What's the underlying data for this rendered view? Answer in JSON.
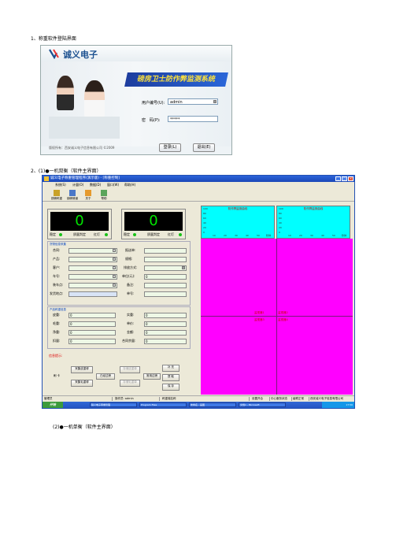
{
  "headings": {
    "step1": "1、称重软件登陆界面",
    "step2": "2、(1)●一机双衡（软件主界面）",
    "step3": "(2)●一机单衡（软件主界面）"
  },
  "login": {
    "brand": "诚义电子",
    "app_title": "磅房卫士防作弊监测系统",
    "user_label": "用户编号(U):",
    "user_value": "admin",
    "password_label": "密　码(P):",
    "password_value": "*****",
    "login_button": "登录(L)",
    "exit_button": "退出(E)",
    "copyright": "版权所有：西安诚义电子信息有限公司 ©2009"
  },
  "main": {
    "title": "诚义电子称重管理程序(演示版) - [称重控制]",
    "menu": [
      "系统(S)",
      "计量(O)",
      "数据(D)",
      "窗口(W)",
      "帮助(H)"
    ],
    "toolbar": [
      "铜磅称重",
      "钢磅磅道",
      "关于",
      "帮助"
    ],
    "scale1": {
      "value": "0",
      "stable": "稳定",
      "weigh": "质量判定",
      "light": "红灯"
    },
    "scale2": {
      "value": "0",
      "stable": "稳定",
      "weigh": "质量判定",
      "light": "红灯"
    },
    "goods": {
      "title": "货物信息采集",
      "fields_left": [
        "合同:",
        "产品:",
        "客户:",
        "车号:",
        "装车点:",
        "发货地点:"
      ],
      "fields_right": [
        "报送单:",
        "规格:",
        "排放方式:",
        "单位(元):",
        "备注:",
        "单号:"
      ],
      "price_value": "0"
    },
    "weight": {
      "title": "产品称重信息",
      "fields_left": [
        "皮重:",
        "毛重:",
        "净重:",
        "扣量:"
      ],
      "fields_right": [
        "实重:",
        "单价:",
        "金额:",
        "合同余量:"
      ],
      "values_left": [
        "0",
        "0",
        "0",
        "0"
      ],
      "values_right": [
        "0",
        "0",
        "0",
        "0"
      ]
    },
    "prompt": {
      "title": "信息提示:",
      "buttons": [
        "刷 卡",
        "采集皮重秤",
        "采集毛重秤",
        "已经过磅",
        "存储皮重单",
        "存储毛重单",
        "常用过磅",
        "补 充",
        "提 取",
        "保 存"
      ]
    },
    "charts": [
      {
        "title": "防作弊监测曲线",
        "yticks": [
          "100",
          "80",
          "60",
          "40",
          "20",
          "0"
        ],
        "xticks": [
          "10",
          "20",
          "30",
          "40",
          "50"
        ],
        "xlabel": "秒钟"
      },
      {
        "title": "防作弊监测曲线",
        "yticks": [
          "100",
          "80",
          "60",
          "40",
          "20",
          "0"
        ],
        "xticks": [
          "10",
          "20",
          "30",
          "40",
          "50"
        ],
        "xlabel": "秒钟"
      }
    ],
    "monitor_labels": [
      "监视器1",
      "监视器2",
      "监视器3",
      "监视器4"
    ],
    "status": [
      "管理员",
      "操作员: admin",
      "称重端名称",
      "设置开合",
      "中心服务状态",
      "级联正常",
      "西安诚义电子信息有限公司"
    ],
    "taskbar": {
      "start": "开始",
      "tasks": [
        "磅义电子称重管理",
        "Program Files",
        "未命名 - 画图",
        "文档1 - Microsoft"
      ],
      "clock": "17:56"
    }
  }
}
